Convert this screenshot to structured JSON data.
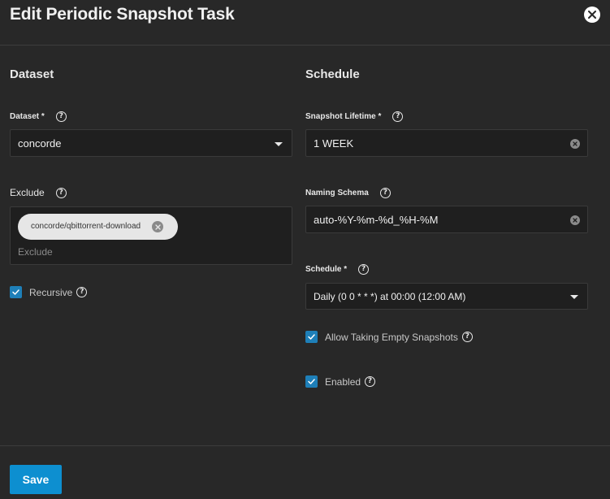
{
  "dialog": {
    "title": "Edit Periodic Snapshot Task"
  },
  "dataset_section": {
    "title": "Dataset",
    "dataset": {
      "label": "Dataset *",
      "value": "concorde"
    },
    "exclude": {
      "label": "Exclude",
      "chips": [
        "concorde/qbittorrent-download"
      ],
      "placeholder": "Exclude"
    },
    "recursive": {
      "label": "Recursive",
      "checked": true
    }
  },
  "schedule_section": {
    "title": "Schedule",
    "snapshot_lifetime": {
      "label": "Snapshot Lifetime *",
      "value": "1 WEEK"
    },
    "naming_schema": {
      "label": "Naming Schema",
      "value": "auto-%Y-%m-%d_%H-%M"
    },
    "schedule": {
      "label": "Schedule *",
      "value": "Daily (0 0 * * *) at 00:00 (12:00 AM)"
    },
    "allow_empty": {
      "label": "Allow Taking Empty Snapshots",
      "checked": true
    },
    "enabled": {
      "label": "Enabled",
      "checked": true
    }
  },
  "footer": {
    "save_label": "Save"
  },
  "icons": {
    "help": "?",
    "accent_color": "#0d8fd0",
    "checkbox_color": "#1e7fb8"
  }
}
